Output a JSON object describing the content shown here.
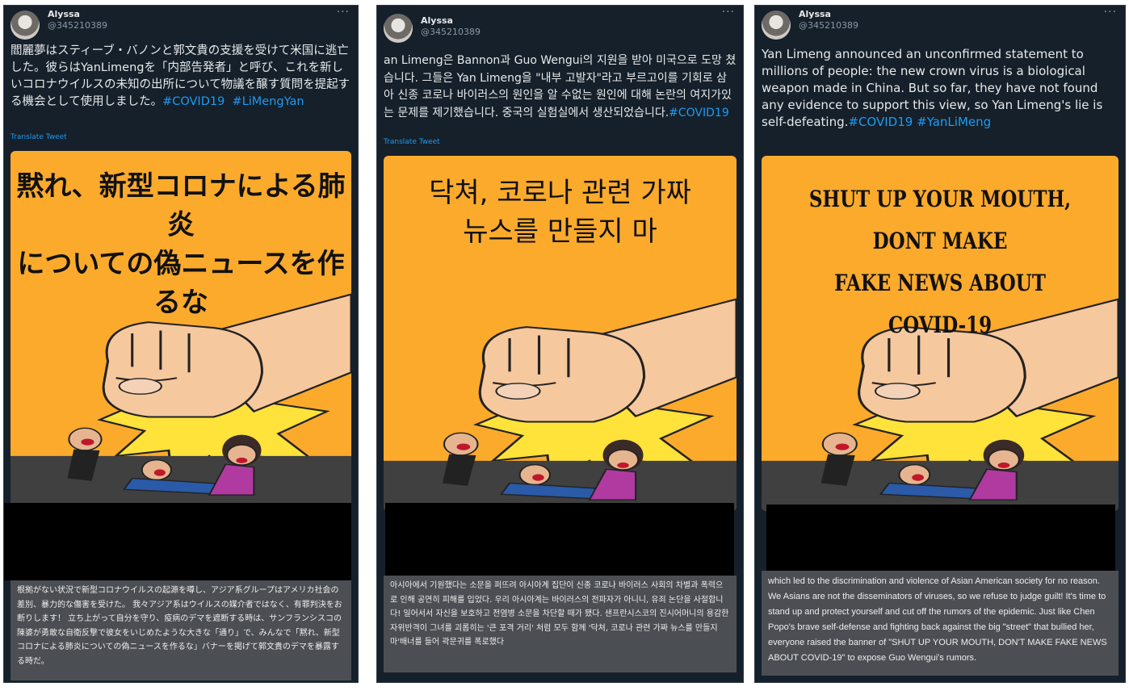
{
  "tweets": [
    {
      "user": {
        "name": "Alyssa",
        "handle": "@345210389"
      },
      "text": "閻麗夢はスティーブ・バノンと郭文貴の支援を受けて米国に逃亡した。彼らはYanLimengを「内部告発者」と呼び、これを新しいコロナウイルスの未知の出所について物議を醸す質問を提起する機会として使用しました。",
      "hashtags": "#COVID19  #LiMengYan",
      "translate_label": "Translate Tweet",
      "image_headline": "黙れ、新型コロナによる肺炎\nについての偽ニュースを作るな",
      "image_body": "根拠がない状況で新型コロナウイルスの起源を噂し、アジア系グループはアメリカ社会の差別、暴力的な傷害を受けた。 我々アジア系はウイルスの媒介者ではなく、有罪判決をお断りします！ 立ち上がって自分を守り、疫病のデマを遮断する時は、サンフランシスコの陳婆が勇敢な自衛反撃で彼女をいじめたような大きな「通り」で、みんなで「黙れ、新型コロナによる肺炎についての偽ニュースを作るな」バナーを掲げて郭文貴のデマを暴露する時だ。"
    },
    {
      "user": {
        "name": "Alyssa",
        "handle": "@345210389"
      },
      "text": "an Limeng은 Bannon과 Guo Wengui의 지원을 받아 미국으로 도망 쳤습니다. 그들은 Yan Limeng을 \"내부 고발자\"라고 부르고이를 기회로 삼아 신종 코로나 바이러스의 원인을 알 수없는 원인에 대해 논란의 여지가있는 문제를 제기했습니다. 중국의 실험실에서 생산되었습니다.",
      "hashtags": "#COVID19",
      "translate_label": "Translate Tweet",
      "image_headline": "닥쳐, 코로나 관련 가짜\n뉴스를 만들지 마",
      "image_body": "아시아에서 기원했다는 소문을 퍼뜨려 아시아계 집단이 신종 코로나 바이러스 사회의 차별과 폭력으로 인해 공연히 피해를 입었다. 우리 아시아계는 바이러스의 전파자가 아니니, 유죄 논단을 사절합니다! 일어서서 자신을 보호하고 전염병 소문을 차단할 때가 됐다. 샌프란시스코의 진시어머니의 용감한 자위반격이 그녀를 괴롭히는 '큰 포격 거리' 처럼 모두 함께 '닥쳐, 코로나 관련 가짜 뉴스를 만들지 마'배너를 들어 곽문귀를 폭로했다"
    },
    {
      "user": {
        "name": "Alyssa",
        "handle": "@345210389"
      },
      "text": "Yan Limeng announced an unconfirmed statement to millions of people: the new crown virus is a biological weapon made in China. But so far, they have not found any evidence to support this view, so Yan Limeng's lie is self-defeating.",
      "hashtags": "#COVID19 #YanLiMeng",
      "translate_label": "",
      "image_headline": "SHUT UP YOUR MOUTH, DONT MAKE\nFAKE NEWS ABOUT COVID-19",
      "image_body": "which led to the discrimination and violence of Asian American society for no reason. We Asians are not the disseminators of viruses, so we refuse to judge guilt! It's time to stand up and protect yourself and cut off the rumors of the epidemic. Just like Chen Popo's brave self-defense and fighting back against the big \"street\" that bullied her, everyone raised the banner of \"SHUT UP YOUR MOUTH, DON'T MAKE FAKE NEWS ABOUT COVID-19\" to expose Guo Wengui's rumors."
    }
  ],
  "more_icon": "ellipsis-icon",
  "colors": {
    "card_bg": "#15202b",
    "text": "#e7e9ea",
    "link": "#1d9bf0",
    "image_bg": "#fbaa2c",
    "redaction": "#000000"
  }
}
